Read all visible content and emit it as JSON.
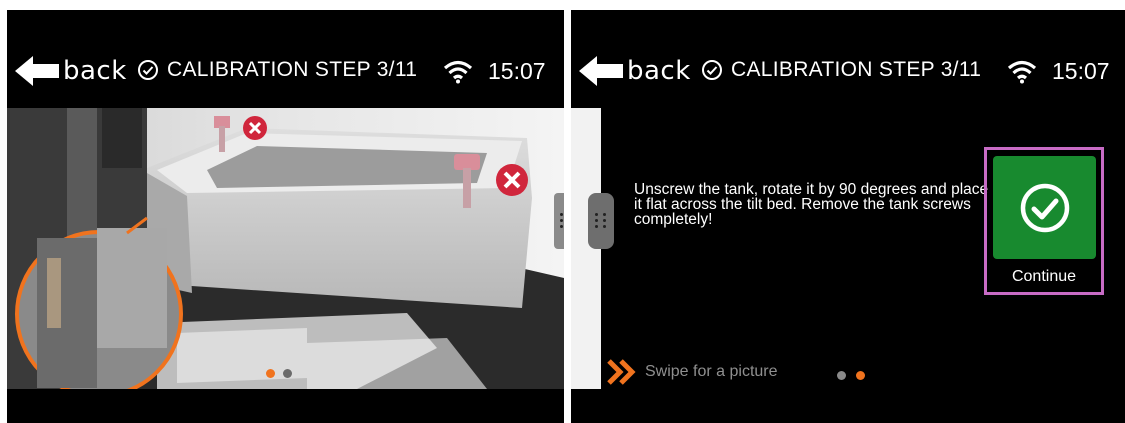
{
  "screens": [
    {
      "header": {
        "back_label": "back",
        "title": "CALIBRATION STEP 3/11",
        "time": "15:07"
      },
      "pager": {
        "active_index": 0,
        "count": 2
      }
    },
    {
      "header": {
        "back_label": "back",
        "title": "CALIBRATION STEP 3/11",
        "time": "15:07"
      },
      "instruction": "Unscrew the tank, rotate it by 90 degrees and place it flat across the tilt bed. Remove the tank screws completely!",
      "continue_label": "Continue",
      "swipe_hint": "Swipe for a picture",
      "pager": {
        "active_index": 1,
        "count": 2
      }
    }
  ],
  "colors": {
    "accent_orange": "#f0731e",
    "continue_green": "#188a2f",
    "highlight_pink": "#c76bc5",
    "error_red": "#d0263c"
  },
  "icons": [
    "back-arrow-icon",
    "check-circle-icon",
    "wifi-icon",
    "remove-x-icon",
    "drag-handle-icon",
    "check-icon",
    "double-chevron-icon"
  ]
}
